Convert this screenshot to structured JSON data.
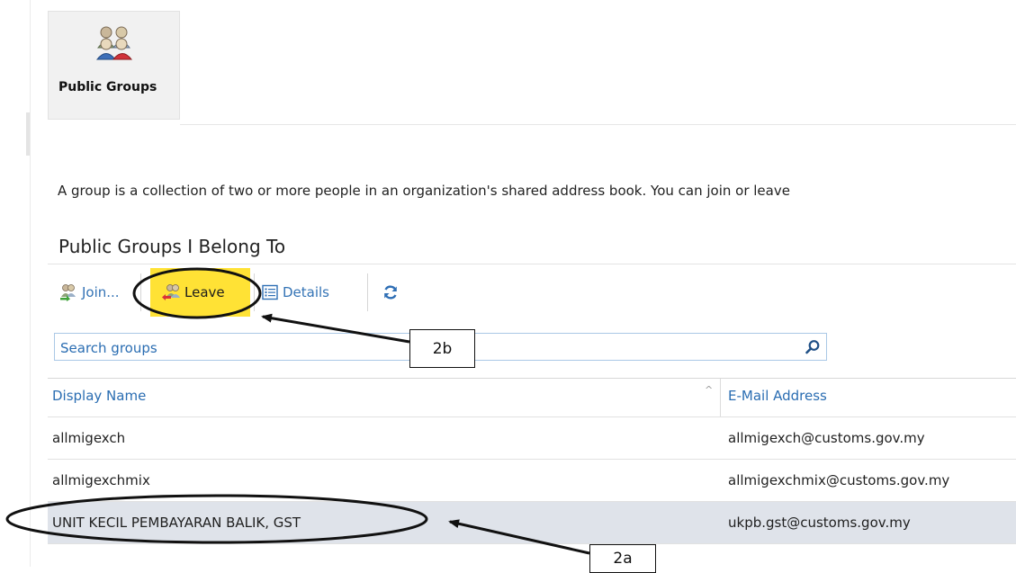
{
  "tile": {
    "label": "Public Groups",
    "icon": "people-group-icon"
  },
  "intro": "A group is a collection of two or more people in an organization's shared address book. You can join or leave",
  "section_title": "Public Groups I Belong To",
  "toolbar": {
    "join_label": "Join...",
    "leave_label": "Leave",
    "details_label": "Details",
    "refresh_icon": "refresh-icon",
    "leave_highlight": "#ffe235"
  },
  "search": {
    "placeholder": "Search groups",
    "icon": "search-icon"
  },
  "grid": {
    "headers": {
      "name": "Display Name",
      "email": "E-Mail Address"
    },
    "rows": [
      {
        "name": "allmigexch",
        "email": "allmigexch@customs.gov.my"
      },
      {
        "name": "allmigexchmix",
        "email": "allmigexchmix@customs.gov.my"
      },
      {
        "name": "UNIT KECIL PEMBAYARAN BALIK, GST",
        "email": "ukpb.gst@customs.gov.my"
      }
    ]
  },
  "annotations": {
    "callout_leave": "2b",
    "callout_row": "2a"
  },
  "colors": {
    "link": "#2a6db2",
    "selected_row": "#dfe3ea"
  }
}
